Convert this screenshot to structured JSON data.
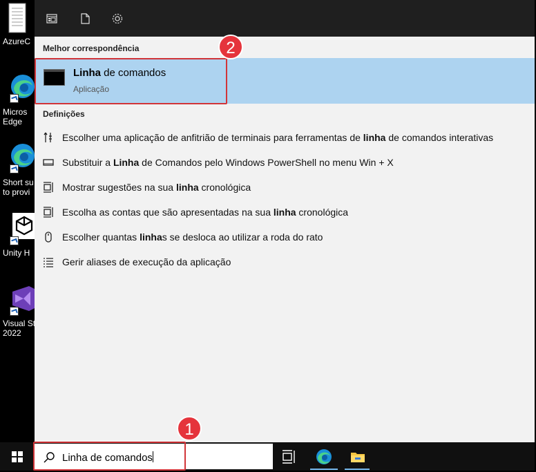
{
  "desktop": {
    "icons": [
      {
        "label": "AzureC",
        "icon": "document-icon"
      },
      {
        "label": "Micros\nEdge",
        "icon": "edge-icon"
      },
      {
        "label": "Short su\nto provi",
        "icon": "edge-icon"
      },
      {
        "label": "Unity H",
        "icon": "unity-icon"
      },
      {
        "label": "Visual St\n2022",
        "icon": "visual-studio-icon"
      }
    ]
  },
  "topbar": {
    "icons": [
      "apps-icon",
      "documents-icon",
      "settings-gear-icon"
    ]
  },
  "best_match": {
    "header": "Melhor correspondência",
    "title_bold": "Linha",
    "title_rest": " de comandos",
    "subtitle": "Aplicação"
  },
  "settings": {
    "header": "Definições",
    "items": [
      {
        "icon": "terminal-settings-icon",
        "pre": "Escolher uma aplicação de anfitrião de terminais para ferramentas de ",
        "bold": "linha",
        "post": " de comandos interativas"
      },
      {
        "icon": "taskbar-icon",
        "pre": "Substituir a ",
        "bold": "Linha",
        "post": " de Comandos pelo Windows PowerShell no menu Win + X"
      },
      {
        "icon": "timeline-icon",
        "pre": "Mostrar sugestões na sua ",
        "bold": "linha",
        "post": " cronológica"
      },
      {
        "icon": "timeline-icon",
        "pre": "Escolha as contas que são apresentadas na sua ",
        "bold": "linha",
        "post": " cronológica"
      },
      {
        "icon": "mouse-icon",
        "pre": "Escolher quantas ",
        "bold": "linha",
        "post": "s se desloca ao utilizar a roda do rato"
      },
      {
        "icon": "list-icon",
        "pre": "Gerir aliases de execução da aplicação",
        "bold": "",
        "post": ""
      }
    ]
  },
  "taskbar": {
    "search_value": "Linha de comandos",
    "apps": [
      "task-view-icon",
      "edge-icon",
      "file-explorer-icon"
    ]
  },
  "annotations": {
    "badge_1": "1",
    "badge_2": "2"
  },
  "colors": {
    "highlight": "#add3f0",
    "annotation_red": "#e5343c",
    "panel_bg": "#f2f2f2",
    "topbar_bg": "#1f1f1f"
  }
}
